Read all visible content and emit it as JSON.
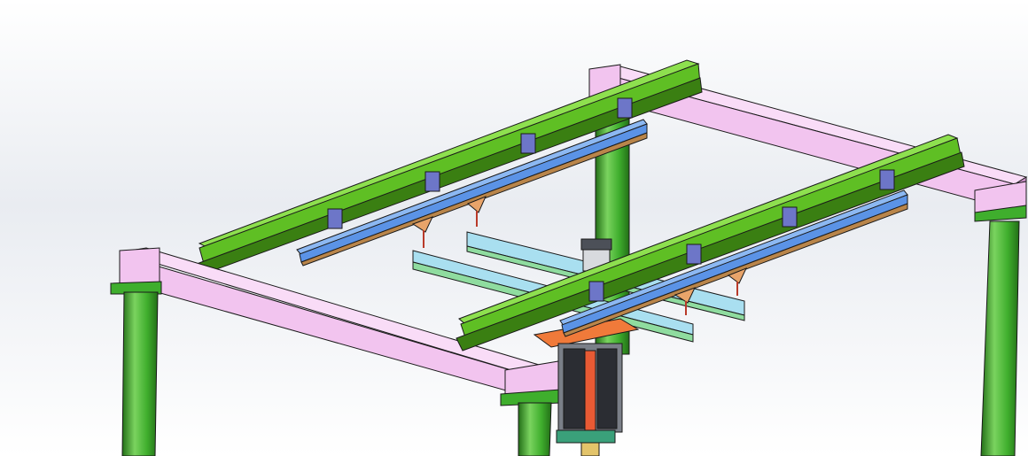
{
  "viewport": {
    "background_top": "#ffffff",
    "background_mid": "#e9ecf1",
    "background_bottom": "#ffffff"
  },
  "colors": {
    "column": "#3fae2d",
    "column_light": "#7ad35f",
    "column_dark": "#236f17",
    "runway_beam": "#f2c4ef",
    "runway_beam_top": "#f9dcf7",
    "runway_beam_dark": "#c98fc6",
    "girder": "#5fbf24",
    "girder_top": "#8ee04f",
    "girder_dark": "#3a7f12",
    "rail": "#5b93e6",
    "rail_top": "#8cb8f2",
    "rail_bottom": "#b9854a",
    "bridge_rail": "#a9dff0",
    "bridge_rail_bottom": "#8fdc9f",
    "bracket": "#6d76c8",
    "hoist_plate": "#f07a3a",
    "hoist_body": "#7a7f88",
    "edge": "#1a1a1a"
  }
}
